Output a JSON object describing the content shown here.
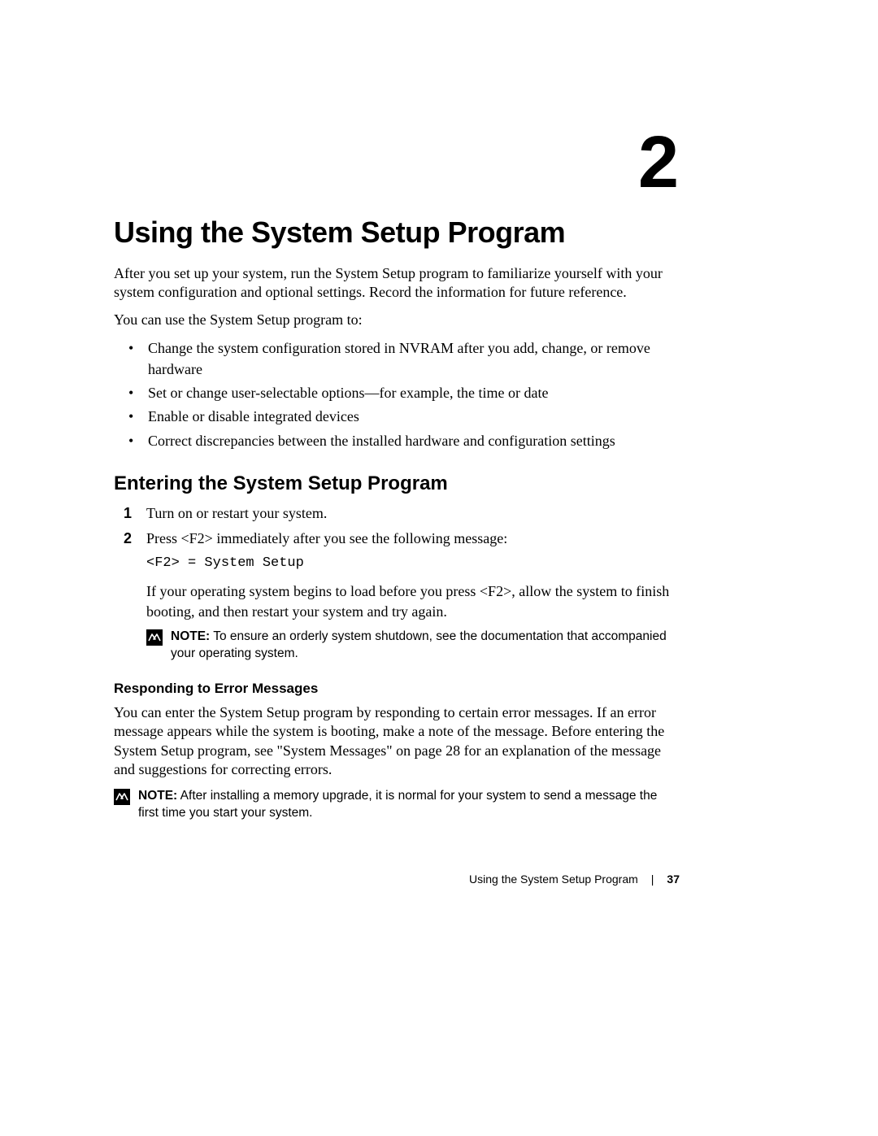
{
  "chapter_number": "2",
  "title": "Using the System Setup Program",
  "intro_paragraphs": [
    "After you set up your system, run the System Setup program to familiarize yourself with your system configuration and optional settings. Record the information for future reference.",
    "You can use the System Setup program to:"
  ],
  "bullets": [
    "Change the system configuration stored in NVRAM after you add, change, or remove hardware",
    "Set or change user-selectable options—for example, the time or date",
    "Enable or disable integrated devices",
    "Correct discrepancies between the installed hardware and configuration settings"
  ],
  "section_heading": "Entering the System Setup Program",
  "steps": {
    "step1": "Turn on or restart your system.",
    "step2_lead": "Press <F2> immediately after you see the following message:",
    "step2_code": "<F2> = System Setup",
    "step2_followup": "If your operating system begins to load before you press <F2>, allow the system to finish booting, and then restart your system and try again."
  },
  "note1_label": "NOTE:",
  "note1_text": "To ensure an orderly system shutdown, see the documentation that accompanied your operating system.",
  "subsection_heading": "Responding to Error Messages",
  "error_paragraph": "You can enter the System Setup program by responding to certain error messages. If an error message appears while the system is booting, make a note of the message. Before entering the System Setup program, see \"System Messages\" on page 28 for an explanation of the message and suggestions for correcting errors.",
  "note2_label": "NOTE:",
  "note2_text": "After installing a memory upgrade, it is normal for your system to send a message the first time you start your system.",
  "footer_title": "Using the System Setup Program",
  "footer_page": "37"
}
